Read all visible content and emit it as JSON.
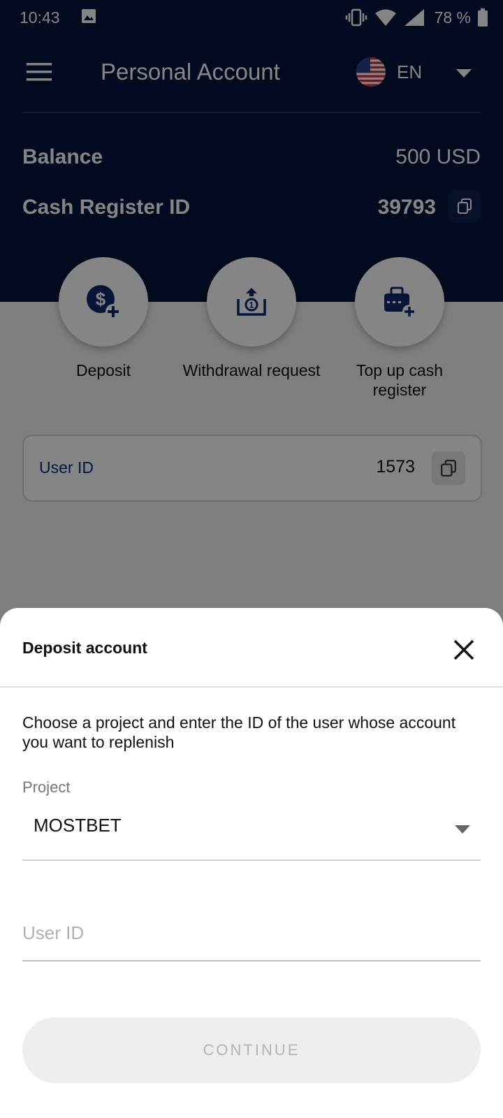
{
  "status_bar": {
    "time": "10:43",
    "battery": "78 %"
  },
  "header": {
    "title": "Personal Account",
    "language": "EN"
  },
  "account": {
    "balance_label": "Balance",
    "balance_value": "500 USD",
    "cash_register_label": "Cash Register ID",
    "cash_register_value": "39793"
  },
  "actions": [
    {
      "label": "Deposit",
      "icon": "dollar-plus-icon"
    },
    {
      "label": "Withdrawal request",
      "icon": "withdraw-box-icon"
    },
    {
      "label": "Top up cash register",
      "icon": "cash-register-plus-icon"
    }
  ],
  "user_card": {
    "label": "User ID",
    "value": "1573"
  },
  "sheet": {
    "title": "Deposit account",
    "description": "Choose a project and enter the ID of the user whose account you want to replenish",
    "project_label": "Project",
    "project_value": "MOSTBET",
    "userid_placeholder": "User ID",
    "continue_label": "CONTINUE"
  },
  "colors": {
    "header_bg": "#03143a",
    "accent": "#0a2a6a",
    "sheet_bg": "#ffffff"
  }
}
